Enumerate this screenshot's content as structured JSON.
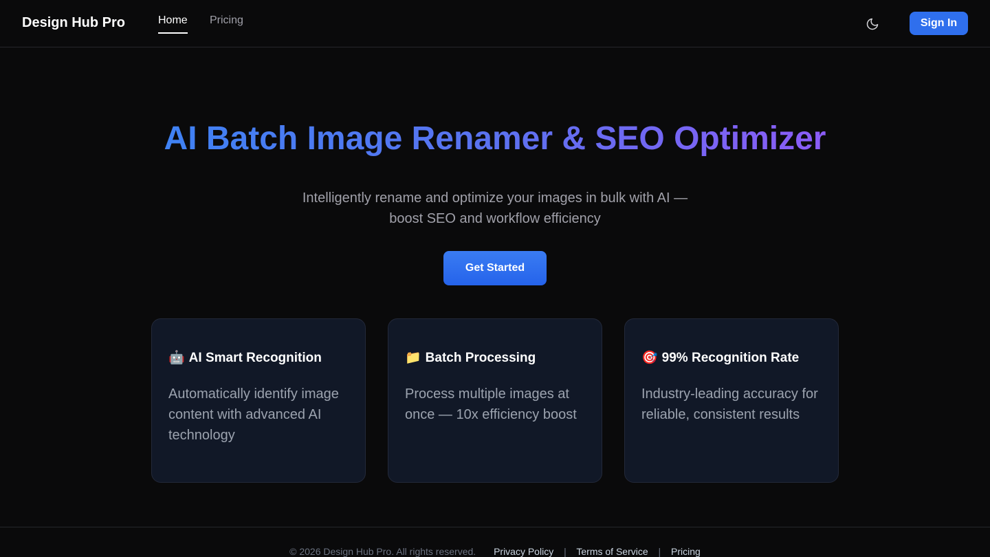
{
  "header": {
    "brand": "Design Hub Pro",
    "nav": [
      {
        "label": "Home",
        "active": true
      },
      {
        "label": "Pricing",
        "active": false
      }
    ],
    "theme_icon": "moon-icon",
    "signin_label": "Sign In"
  },
  "hero": {
    "title": "AI Batch Image Renamer & SEO Optimizer",
    "subtitle": "Intelligently rename and optimize your images in bulk with AI — boost SEO and workflow efficiency",
    "cta_label": "Get Started"
  },
  "features": [
    {
      "icon": "🤖",
      "icon_name": "robot-icon",
      "title": "AI Smart Recognition",
      "text": "Automatically identify image content with advanced AI technology"
    },
    {
      "icon": "📁",
      "icon_name": "folder-icon",
      "title": "Batch Processing",
      "text": "Process multiple images at once — 10x efficiency boost"
    },
    {
      "icon": "🎯",
      "icon_name": "target-icon",
      "title": "99% Recognition Rate",
      "text": "Industry-leading accuracy for reliable, consistent results"
    }
  ],
  "footer": {
    "copyright": "© 2026 Design Hub Pro. All rights reserved.",
    "links": [
      "Privacy Policy",
      "Terms of Service",
      "Pricing"
    ],
    "separator": "|"
  },
  "colors": {
    "background": "#0a0a0b",
    "accent": "#2f6fed",
    "gradient_start": "#3f82f4",
    "gradient_end": "#8b5cf6",
    "card_bg": "#111827"
  }
}
